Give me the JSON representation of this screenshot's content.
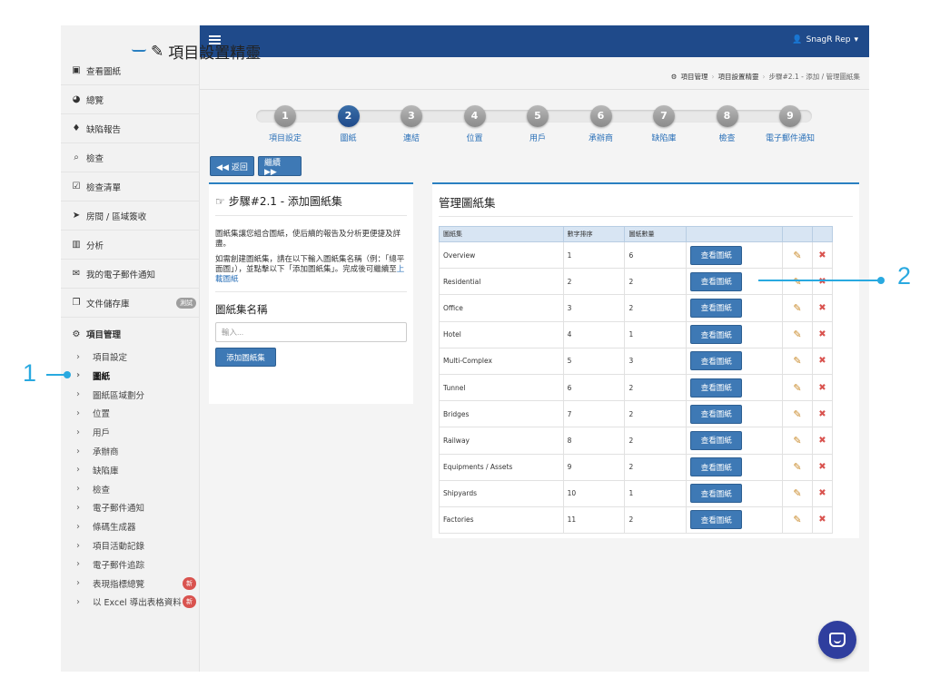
{
  "user": {
    "name": "SnagR Rep"
  },
  "sidebar": {
    "items": [
      {
        "icon": "image-icon",
        "glyph": "▣",
        "label": "查看圖紙"
      },
      {
        "icon": "dashboard-icon",
        "glyph": "◕",
        "label": "總覽"
      },
      {
        "icon": "pin-icon",
        "glyph": "♦",
        "label": "缺陷報告"
      },
      {
        "icon": "search-icon",
        "glyph": "⌕",
        "label": "檢查"
      },
      {
        "icon": "checklist-icon",
        "glyph": "☑",
        "label": "檢查清單"
      },
      {
        "icon": "location-arrow-icon",
        "glyph": "➤",
        "label": "房間 / 區域簽收"
      },
      {
        "icon": "bar-chart-icon",
        "glyph": "▥",
        "label": "分析"
      },
      {
        "icon": "envelope-icon",
        "glyph": "✉",
        "label": "我的電子郵件通知"
      },
      {
        "icon": "documents-icon",
        "glyph": "❐",
        "label": "文件儲存庫",
        "badge": "測試"
      }
    ],
    "section_header": {
      "icon": "gears-icon",
      "glyph": "⚙",
      "label": "項目管理"
    },
    "sub_items": [
      {
        "label": "項目設定"
      },
      {
        "label": "圖紙"
      },
      {
        "label": "圖紙區域劃分"
      },
      {
        "label": "位置"
      },
      {
        "label": "用戶"
      },
      {
        "label": "承辦商"
      },
      {
        "label": "缺陷庫"
      },
      {
        "label": "檢查"
      },
      {
        "label": "電子郵件通知"
      },
      {
        "label": "條碼生成器"
      },
      {
        "label": "項目活動記錄"
      },
      {
        "label": "電子郵件追踪"
      },
      {
        "label": "表現指標總覽",
        "badge": "新"
      },
      {
        "label": "以 Excel 導出表格資料",
        "badge": "新"
      }
    ]
  },
  "page": {
    "title": "項目設置精靈"
  },
  "breadcrumb": {
    "items": [
      "項目管理",
      "項目設置精靈"
    ],
    "current": "步驟#2.1 - 添加 / 管理圖紙集"
  },
  "wizard": {
    "steps": [
      {
        "num": "1",
        "label": "項目設定"
      },
      {
        "num": "2",
        "label": "圖紙"
      },
      {
        "num": "3",
        "label": "連結"
      },
      {
        "num": "4",
        "label": "位置"
      },
      {
        "num": "5",
        "label": "用戶"
      },
      {
        "num": "6",
        "label": "承辦商"
      },
      {
        "num": "7",
        "label": "缺陷庫"
      },
      {
        "num": "8",
        "label": "檢查"
      },
      {
        "num": "9",
        "label": "電子郵件通知"
      }
    ],
    "active_step": 2
  },
  "nav": {
    "back_label": "◀◀ 返回",
    "next_label": "繼續 ▶▶"
  },
  "left_panel": {
    "title": "步驟#2.1 - 添加圖紙集",
    "desc1": "圖紙集讓您組合圖紙，使后續的報告及分析更便捷及詳盡。",
    "desc2_before": "如需創建圖紙集，請在以下輸入圖紙集名稱（例：「總平面圖」），並點擊以下「添加圖紙集」。完成後可繼續至",
    "desc2_link": "上載圖紙",
    "field_label": "圖紙集名稱",
    "input_value": "",
    "input_placeholder": "輸入...",
    "add_button": "添加圖紙集"
  },
  "right_panel": {
    "title": "管理圖紙集",
    "columns": [
      "圖紙集",
      "數字排序",
      "圖紙數量",
      "",
      "",
      ""
    ],
    "view_button": "查看圖紙",
    "rows": [
      {
        "name": "Overview",
        "order": "1",
        "count": "6"
      },
      {
        "name": "Residential",
        "order": "2",
        "count": "2"
      },
      {
        "name": "Office",
        "order": "3",
        "count": "2"
      },
      {
        "name": "Hotel",
        "order": "4",
        "count": "1"
      },
      {
        "name": "Multi-Complex",
        "order": "5",
        "count": "3"
      },
      {
        "name": "Tunnel",
        "order": "6",
        "count": "2"
      },
      {
        "name": "Bridges",
        "order": "7",
        "count": "2"
      },
      {
        "name": "Railway",
        "order": "8",
        "count": "2"
      },
      {
        "name": "Equipments / Assets",
        "order": "9",
        "count": "2"
      },
      {
        "name": "Shipyards",
        "order": "10",
        "count": "1"
      },
      {
        "name": "Factories",
        "order": "11",
        "count": "2"
      }
    ]
  },
  "callouts": {
    "one": "1",
    "two": "2"
  },
  "colors": {
    "topbar": "#1f4a8a",
    "accent": "#3e79b5",
    "callout": "#29a9e0",
    "badge_new": "#d9534f"
  }
}
